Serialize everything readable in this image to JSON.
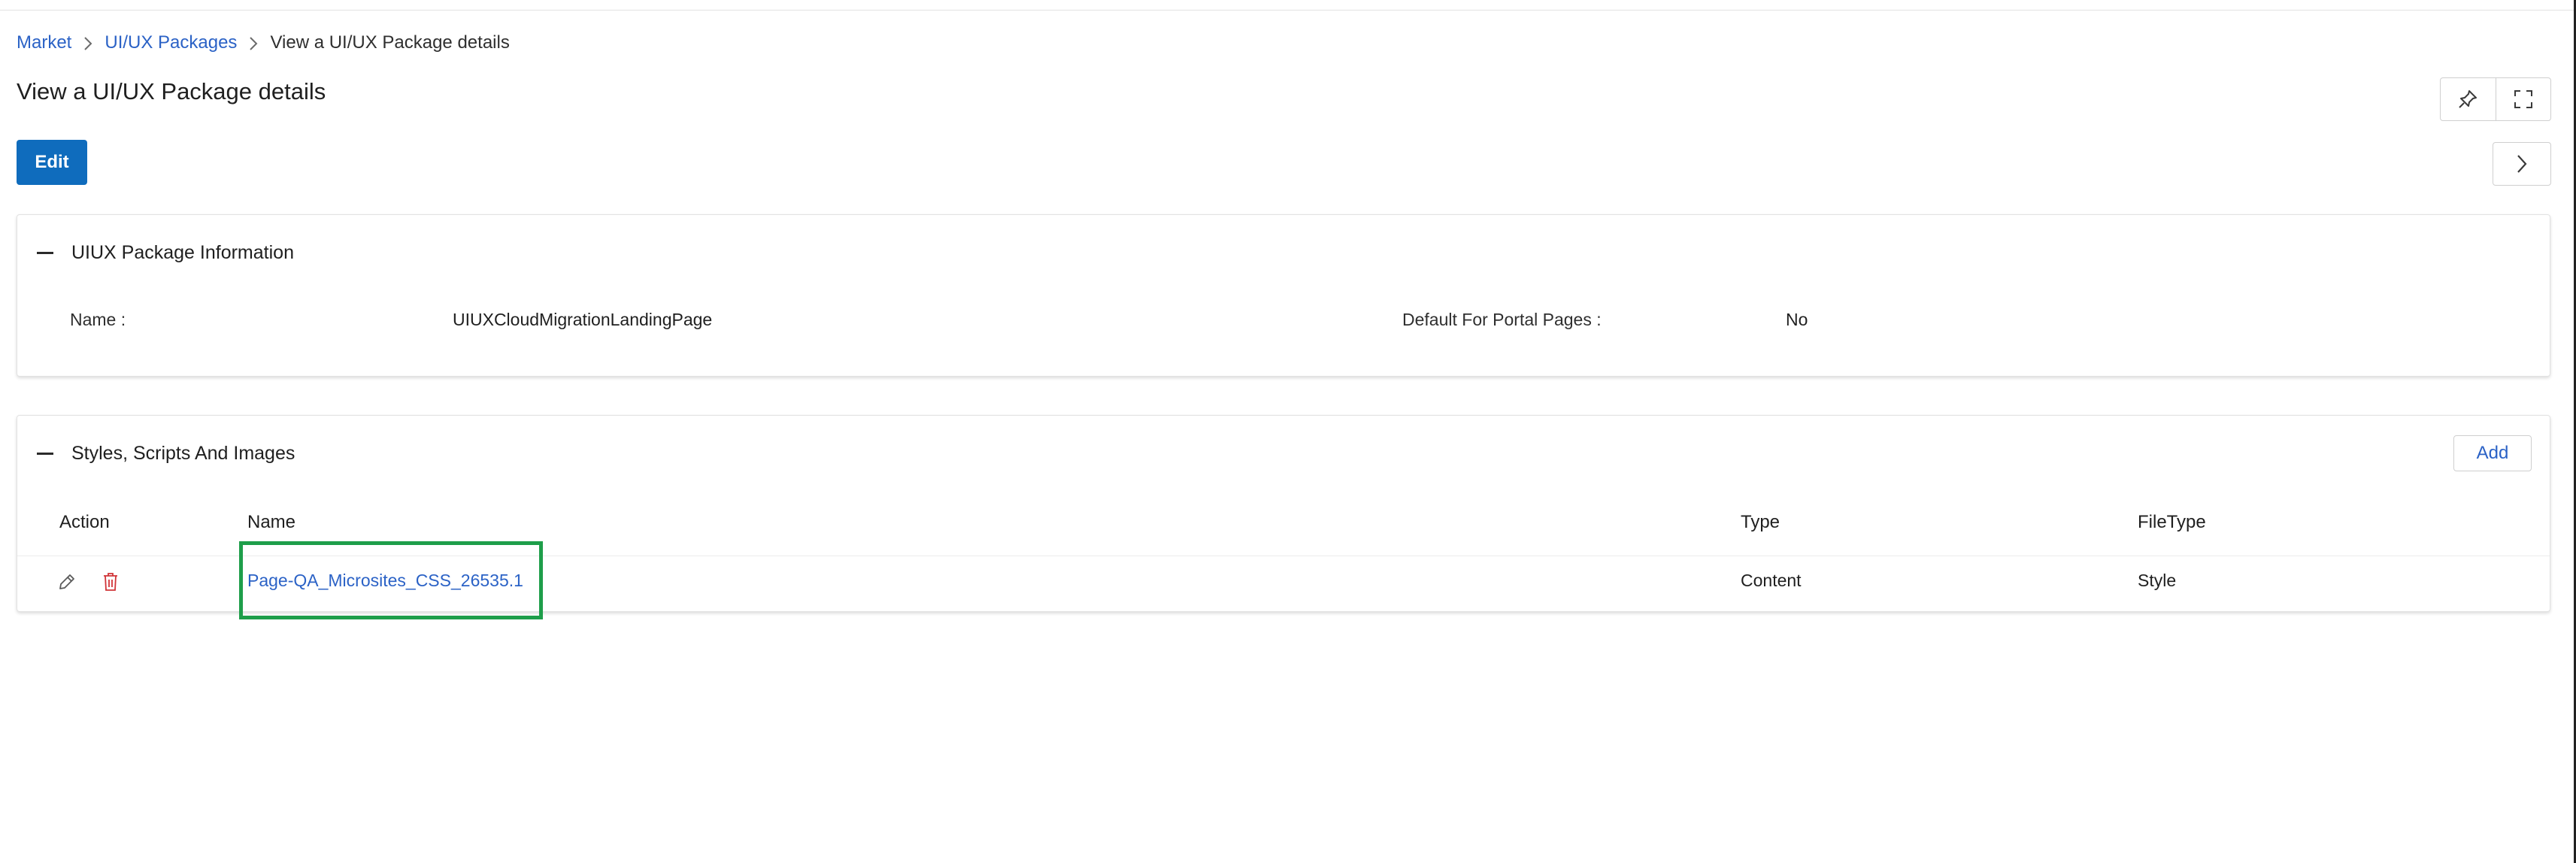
{
  "breadcrumb": {
    "items": [
      "Market",
      "UI/UX Packages"
    ],
    "current": "View a UI/UX Package details"
  },
  "page": {
    "title": "View a UI/UX Package details",
    "edit_label": "Edit"
  },
  "icons": {
    "pin": "pin-icon",
    "fullscreen": "fullscreen-icon",
    "next": "chevron-right-icon",
    "edit_row": "pencil-icon",
    "delete_row": "trash-icon"
  },
  "info_section": {
    "title": "UIUX Package Information",
    "name_label": "Name :",
    "name_value": "UIUXCloudMigrationLandingPage",
    "default_label": "Default For Portal Pages :",
    "default_value": "No"
  },
  "assets_section": {
    "title": "Styles, Scripts And Images",
    "add_label": "Add",
    "columns": [
      "Action",
      "Name",
      "Type",
      "FileType"
    ],
    "rows": [
      {
        "name": "Page-QA_Microsites_CSS_26535.1",
        "type": "Content",
        "filetype": "Style"
      }
    ]
  },
  "colors": {
    "primary": "#0f6cbd",
    "link": "#2b62c6",
    "delete": "#d13438",
    "highlight": "#1e9e4a"
  }
}
